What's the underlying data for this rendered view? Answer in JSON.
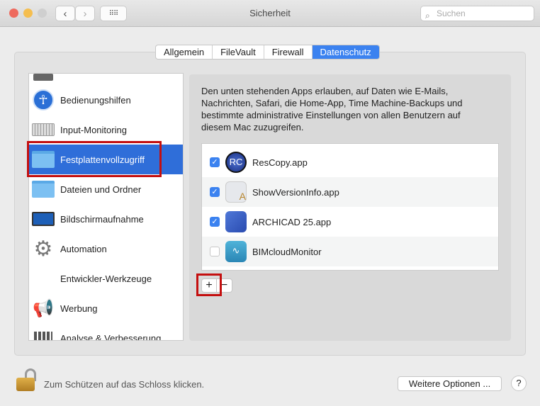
{
  "window": {
    "title": "Sicherheit",
    "search_placeholder": "Suchen"
  },
  "tabs": [
    {
      "label": "Allgemein"
    },
    {
      "label": "FileVault"
    },
    {
      "label": "Firewall"
    },
    {
      "label": "Datenschutz",
      "active": true
    }
  ],
  "sidebar": {
    "items": [
      {
        "label": "Bedienungshilfen",
        "icon": "accessibility-icon"
      },
      {
        "label": "Input-Monitoring",
        "icon": "keyboard-icon"
      },
      {
        "label": "Festplattenvollzugriff",
        "icon": "folder-icon",
        "selected": true
      },
      {
        "label": "Dateien und Ordner",
        "icon": "folder-icon"
      },
      {
        "label": "Bildschirmaufnahme",
        "icon": "display-icon"
      },
      {
        "label": "Automation",
        "icon": "gear-icon"
      },
      {
        "label": "Entwickler-Werkzeuge",
        "icon": "none"
      },
      {
        "label": "Werbung",
        "icon": "megaphone-icon"
      },
      {
        "label": "Analyse & Verbesserung",
        "icon": "chart-icon"
      }
    ]
  },
  "description": "Den unten stehenden Apps erlauben, auf Daten wie E-Mails, Nachrichten, Safari, die Home-App, Time Machine-Backups und bestimmte administrative Einstellungen von allen Benutzern auf diesem Mac zuzugreifen.",
  "apps": [
    {
      "name": "ResCopy.app",
      "checked": true
    },
    {
      "name": "ShowVersionInfo.app",
      "checked": true
    },
    {
      "name": "ARCHICAD 25.app",
      "checked": true
    },
    {
      "name": "BIMcloudMonitor",
      "checked": false
    }
  ],
  "buttons": {
    "add": "+",
    "remove": "−",
    "more_options": "Weitere Optionen ...",
    "help": "?"
  },
  "footer": {
    "lock_text": "Zum Schützen auf das Schloss klicken."
  },
  "colors": {
    "accent": "#3b82f0",
    "selection": "#2f6ed9",
    "highlight": "#c40f0f"
  }
}
